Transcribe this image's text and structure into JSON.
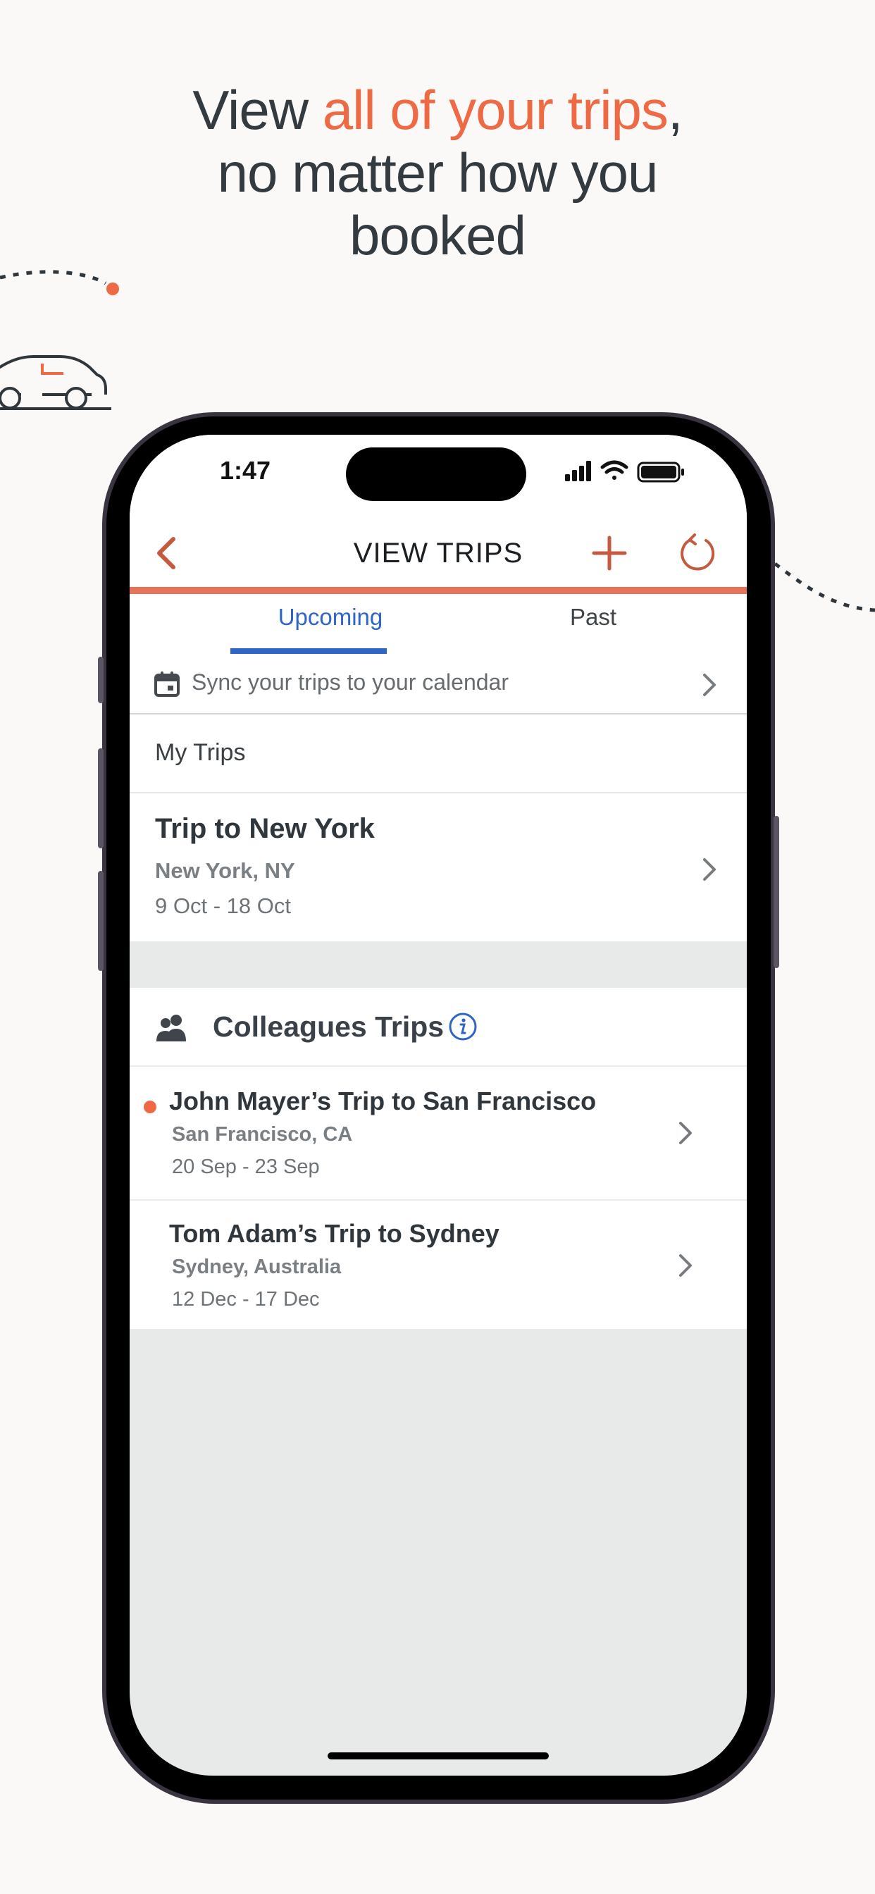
{
  "headline": {
    "part1": "View ",
    "accent": "all of your trips",
    "part2": ",",
    "line2": "no matter how you",
    "line3": "booked"
  },
  "status_bar": {
    "time": "1:47"
  },
  "nav": {
    "title": "VIEW TRIPS"
  },
  "tabs": [
    {
      "label": "Upcoming",
      "active": true
    },
    {
      "label": "Past",
      "active": false
    }
  ],
  "sync": {
    "label": "Sync your trips to your calendar"
  },
  "my_trips": {
    "header": "My Trips",
    "items": [
      {
        "title": "Trip to New York",
        "location": "New York, NY",
        "dates": "9 Oct - 18 Oct"
      }
    ]
  },
  "colleagues": {
    "header": "Colleagues Trips",
    "items": [
      {
        "title": "John Mayer’s Trip to San Francisco",
        "location": "San Francisco, CA",
        "dates": "20 Sep - 23 Sep",
        "unread": true
      },
      {
        "title": "Tom Adam’s Trip to Sydney",
        "location": "Sydney, Australia",
        "dates": "12 Dec - 17 Dec",
        "unread": false
      }
    ]
  },
  "colors": {
    "accent": "#ee6a45",
    "tab_active": "#2f65c6",
    "text_dark": "#333a40",
    "background": "#fbf9f7"
  }
}
